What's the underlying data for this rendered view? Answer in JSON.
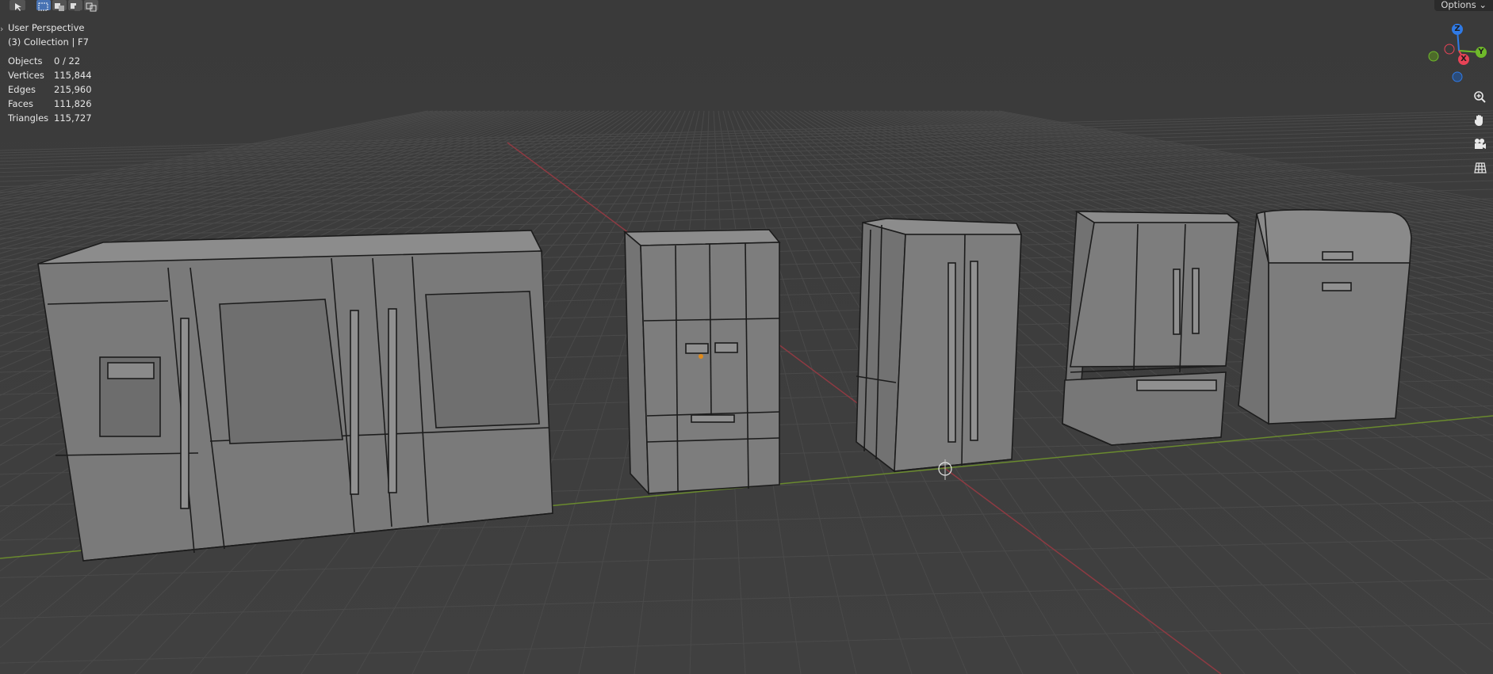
{
  "viewport": {
    "title": "User Perspective",
    "collection": "(3) Collection | F7",
    "stats": [
      {
        "label": "Objects",
        "value": "0 / 22"
      },
      {
        "label": "Vertices",
        "value": "115,844"
      },
      {
        "label": "Edges",
        "value": "215,960"
      },
      {
        "label": "Faces",
        "value": "111,826"
      },
      {
        "label": "Triangles",
        "value": "115,727"
      }
    ]
  },
  "header": {
    "options_label": "Options",
    "options_chevron": "chevron-down-icon",
    "tools": [
      "select-tool-icon",
      "select-box-icon",
      "mode-extend-icon",
      "mode-subtract-icon",
      "mode-intersect-icon"
    ]
  },
  "gizmo": {
    "axes": [
      {
        "label": "Z",
        "color": "#2f7ae6"
      },
      {
        "label": "Y",
        "color": "#6fb92a"
      },
      {
        "label": "X",
        "color": "#e84356"
      }
    ]
  },
  "nav_icons": [
    "zoom-icon",
    "hand-pan-icon",
    "camera-icon",
    "grid-ortho-icon"
  ],
  "colors": {
    "background": "#3d3d3d",
    "grid": "#4a4a4a",
    "x_axis": "#8e3a42",
    "y_axis": "#6a8a2e",
    "model_face": "#7f7f7f",
    "model_edge": "#1c1c1c"
  }
}
